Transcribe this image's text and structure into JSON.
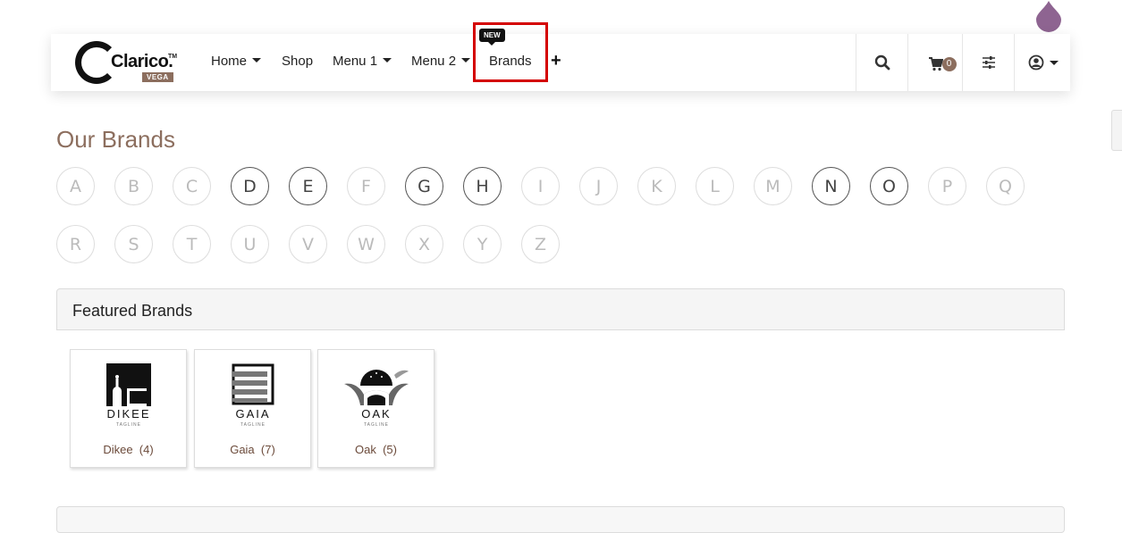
{
  "brand": {
    "name": "Clarico.",
    "tm": "TM",
    "edition": "VEGA"
  },
  "nav": {
    "items": [
      {
        "label": "Home",
        "dropdown": true
      },
      {
        "label": "Shop",
        "dropdown": false
      },
      {
        "label": "Menu 1",
        "dropdown": true
      },
      {
        "label": "Menu 2",
        "dropdown": true
      },
      {
        "label": "Brands",
        "dropdown": false,
        "badge": "NEW"
      }
    ],
    "add_icon": "plus-icon",
    "cart_count": "0",
    "icons": [
      "search-icon",
      "cart-icon",
      "filter-sliders-icon",
      "user-circle-icon"
    ]
  },
  "page": {
    "title": "Our Brands"
  },
  "alphabet": {
    "letters": [
      "A",
      "B",
      "C",
      "D",
      "E",
      "F",
      "G",
      "H",
      "I",
      "J",
      "K",
      "L",
      "M",
      "N",
      "O",
      "P",
      "Q",
      "R",
      "S",
      "T",
      "U",
      "V",
      "W",
      "X",
      "Y",
      "Z"
    ],
    "active": [
      "D",
      "E",
      "G",
      "H",
      "N",
      "O"
    ]
  },
  "featured": {
    "title": "Featured Brands",
    "brands": [
      {
        "name": "Dikee",
        "count": "(4)",
        "logo_text": "DIKEE",
        "tagline": "TAGLINE"
      },
      {
        "name": "Gaia",
        "count": "(7)",
        "logo_text": "GAIA",
        "tagline": "TAGLINE"
      },
      {
        "name": "Oak",
        "count": "(5)",
        "logo_text": "OAK",
        "tagline": "TAGLINE"
      }
    ]
  },
  "colors": {
    "accent": "#8c6e5e",
    "highlight_border": "#d40000",
    "drop": "#8e6491"
  }
}
